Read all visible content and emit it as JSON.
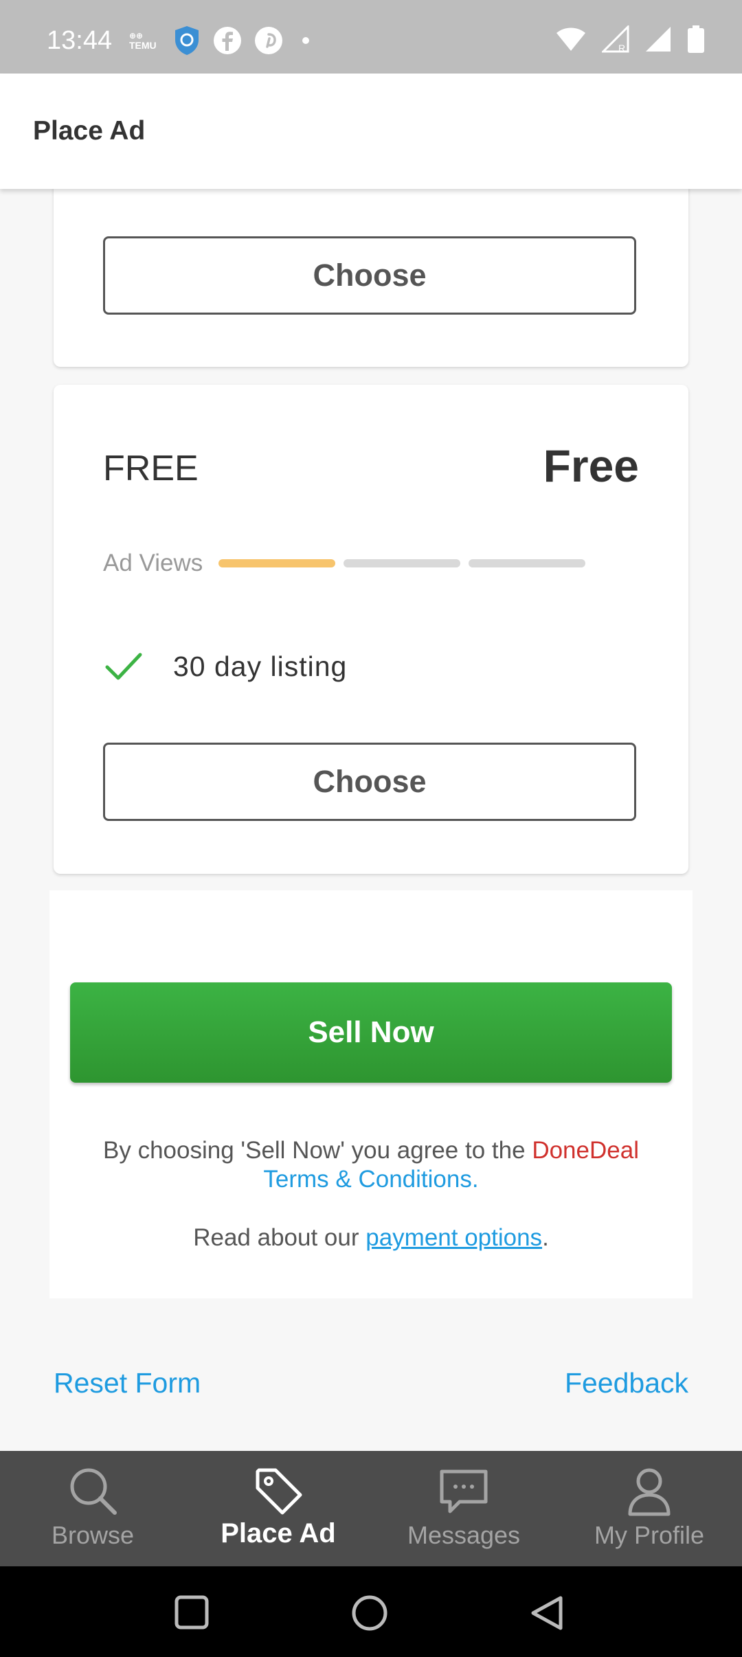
{
  "status_bar": {
    "time": "13:44",
    "left_icons": [
      "temu-icon",
      "shield-icon",
      "facebook-icon",
      "pinterest-icon",
      "dot-icon"
    ],
    "temu_label": "TEMU",
    "right_icons": [
      "wifi-icon",
      "signal-icon",
      "signal-icon",
      "battery-icon"
    ]
  },
  "app_bar": {
    "title": "Place Ad"
  },
  "plans": [
    {
      "choose_label": "Choose"
    },
    {
      "name": "FREE",
      "price": "Free",
      "ad_views_label": "Ad Views",
      "ad_views_level": 1,
      "ad_views_max": 3,
      "features": [
        "30 day listing"
      ],
      "choose_label": "Choose"
    }
  ],
  "sell": {
    "button_label": "Sell Now",
    "terms_prefix": "By choosing 'Sell Now' you agree to the",
    "terms_brand": "DoneDeal",
    "terms_link": "Terms & Conditions.",
    "payment_prefix": "Read about our",
    "payment_link": "payment options",
    "payment_suffix": "."
  },
  "links": {
    "reset": "Reset Form",
    "feedback": "Feedback"
  },
  "bottom_nav": [
    {
      "label": "Browse",
      "icon": "search-icon",
      "active": false
    },
    {
      "label": "Place Ad",
      "icon": "tag-icon",
      "active": true
    },
    {
      "label": "Messages",
      "icon": "chat-icon",
      "active": false
    },
    {
      "label": "My Profile",
      "icon": "user-icon",
      "active": false
    }
  ],
  "colors": {
    "accent_green": "#3cb344",
    "link_blue": "#1e9be0",
    "brand_red": "#d0312d",
    "views_active": "#f7c46c"
  }
}
